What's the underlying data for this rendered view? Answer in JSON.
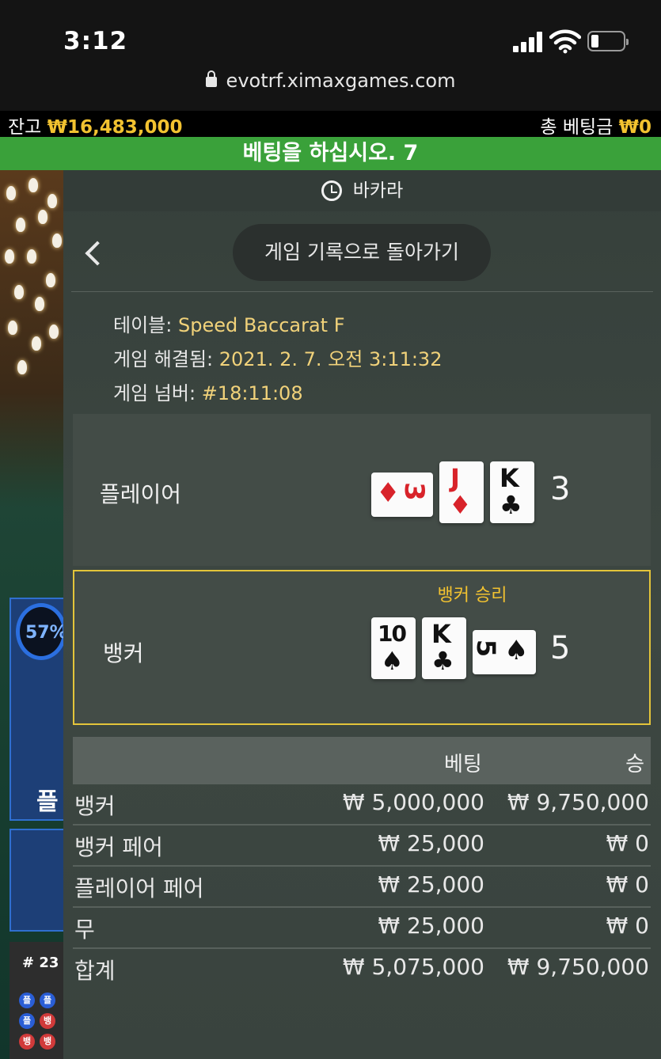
{
  "status_bar": {
    "time": "3:12",
    "url": "evotrf.ximaxgames.com"
  },
  "balance": {
    "label": "잔고",
    "value": "₩16,483,000",
    "total_bet_label": "총 베팅금",
    "total_bet_value": "₩0"
  },
  "banner": {
    "text": "베팅을 하십시오. 7"
  },
  "background": {
    "percent": "57%",
    "player_short": "플",
    "road_hash": "# 23",
    "road_dots": [
      "플",
      "플",
      "플",
      "뱅",
      "뱅",
      "뱅"
    ]
  },
  "panel": {
    "title": "바카라",
    "back_button": "게임 기록으로 돌아가기",
    "table_label": "테이블:",
    "table_value": "Speed Baccarat F",
    "resolved_label": "게임 해결됨:",
    "resolved_value": "2021. 2. 7. 오전 3:11:32",
    "number_label": "게임 넘버:",
    "number_value": "#18:11:08"
  },
  "player": {
    "label": "플레이어",
    "score": "3",
    "cards": [
      {
        "rank": "3",
        "suit": "♦",
        "color": "#d8232a",
        "rotated": true
      },
      {
        "rank": "J",
        "suit": "♦",
        "color": "#d8232a",
        "rotated": false
      },
      {
        "rank": "K",
        "suit": "♣",
        "color": "#111111",
        "rotated": false
      }
    ]
  },
  "banker": {
    "label": "뱅커",
    "score": "5",
    "result": "뱅커 승리",
    "cards": [
      {
        "rank": "10",
        "suit": "♠",
        "color": "#111111",
        "rotated": false
      },
      {
        "rank": "K",
        "suit": "♣",
        "color": "#111111",
        "rotated": false
      },
      {
        "rank": "5",
        "suit": "♠",
        "color": "#111111",
        "rotated": true
      }
    ]
  },
  "bets": {
    "col_bet": "베팅",
    "col_win": "승",
    "rows": [
      {
        "label": "뱅커",
        "bet": "₩ 5,000,000",
        "win": "₩ 9,750,000"
      },
      {
        "label": "뱅커 페어",
        "bet": "₩ 25,000",
        "win": "₩ 0"
      },
      {
        "label": "플레이어 페어",
        "bet": "₩ 25,000",
        "win": "₩ 0"
      },
      {
        "label": "무",
        "bet": "₩ 25,000",
        "win": "₩ 0"
      },
      {
        "label": "합계",
        "bet": "₩ 5,075,000",
        "win": "₩ 9,750,000"
      }
    ]
  }
}
